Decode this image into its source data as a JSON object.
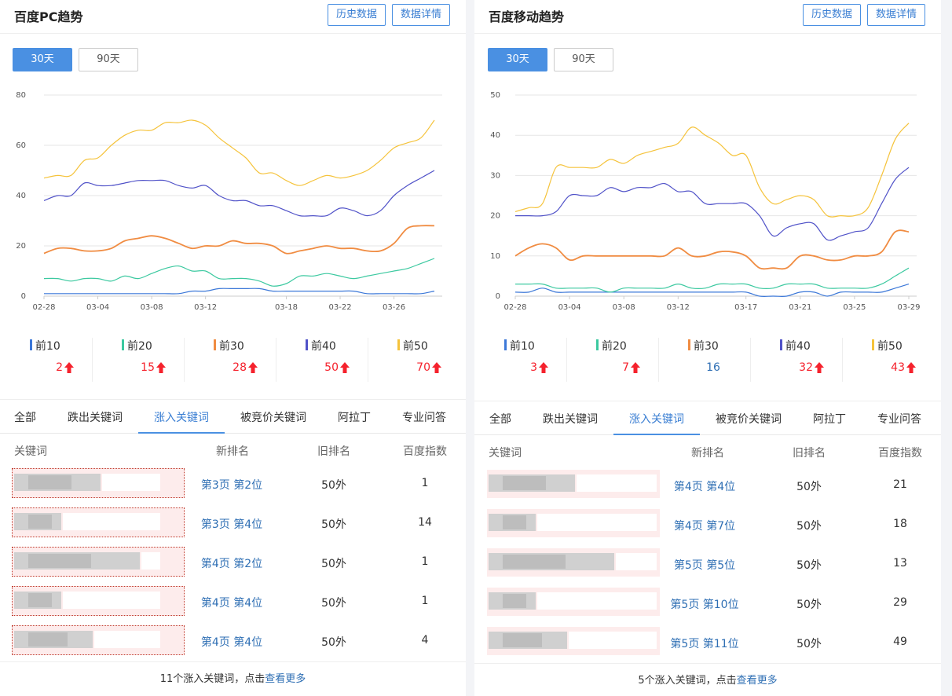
{
  "pc": {
    "title": "百度PC趋势",
    "btn_history": "历史数据",
    "btn_detail": "数据详情",
    "range_30": "30天",
    "range_90": "90天",
    "chart_data": {
      "type": "line",
      "x": [
        "02-28",
        "03-01",
        "03-02",
        "03-03",
        "03-04",
        "03-05",
        "03-06",
        "03-07",
        "03-08",
        "03-09",
        "03-10",
        "03-11",
        "03-12",
        "03-13",
        "03-14",
        "03-15",
        "03-16",
        "03-17",
        "03-18",
        "03-19",
        "03-20",
        "03-21",
        "03-22",
        "03-23",
        "03-24",
        "03-25",
        "03-26",
        "03-27",
        "03-28",
        "03-29"
      ],
      "xticks": [
        "02-28",
        "03-04",
        "03-08",
        "03-12",
        "03-18",
        "03-22",
        "03-26"
      ],
      "ylim": [
        0,
        80
      ],
      "yticks": [
        0,
        20,
        40,
        60,
        80
      ],
      "series": [
        {
          "name": "前10",
          "color": "#3c78d8",
          "values": [
            1,
            1,
            1,
            1,
            1,
            1,
            1,
            1,
            1,
            1,
            1,
            2,
            2,
            3,
            3,
            3,
            3,
            2,
            2,
            2,
            2,
            2,
            2,
            2,
            1,
            1,
            1,
            1,
            1,
            2
          ]
        },
        {
          "name": "前20",
          "color": "#3cc9a0",
          "values": [
            7,
            7,
            6,
            7,
            7,
            6,
            8,
            7,
            9,
            11,
            12,
            10,
            10,
            7,
            7,
            7,
            6,
            4,
            5,
            8,
            8,
            9,
            8,
            7,
            8,
            9,
            10,
            11,
            13,
            15
          ]
        },
        {
          "name": "前30",
          "color": "#f08c42",
          "values": [
            17,
            19,
            19,
            18,
            18,
            19,
            22,
            23,
            24,
            23,
            21,
            19,
            20,
            20,
            22,
            21,
            21,
            20,
            17,
            18,
            19,
            20,
            19,
            19,
            18,
            18,
            21,
            27,
            28,
            28
          ]
        },
        {
          "name": "前40",
          "color": "#5052c8",
          "values": [
            38,
            40,
            40,
            45,
            44,
            44,
            45,
            46,
            46,
            46,
            44,
            43,
            44,
            40,
            38,
            38,
            36,
            36,
            34,
            32,
            32,
            32,
            35,
            34,
            32,
            34,
            40,
            44,
            47,
            50
          ]
        },
        {
          "name": "前50",
          "color": "#f5c33b",
          "values": [
            47,
            48,
            48,
            54,
            55,
            60,
            64,
            66,
            66,
            69,
            69,
            70,
            68,
            63,
            59,
            55,
            49,
            49,
            46,
            44,
            46,
            48,
            47,
            48,
            50,
            54,
            59,
            61,
            63,
            70
          ]
        }
      ]
    },
    "legend": [
      {
        "name": "前10",
        "color": "#3c78d8",
        "value": "2",
        "trend": "up"
      },
      {
        "name": "前20",
        "color": "#3cc9a0",
        "value": "15",
        "trend": "up"
      },
      {
        "name": "前30",
        "color": "#f08c42",
        "value": "28",
        "trend": "up"
      },
      {
        "name": "前40",
        "color": "#5052c8",
        "value": "50",
        "trend": "up"
      },
      {
        "name": "前50",
        "color": "#f5c33b",
        "value": "70",
        "trend": "up"
      }
    ],
    "tabs": [
      "全部",
      "跌出关键词",
      "涨入关键词",
      "被竞价关键词",
      "阿拉丁",
      "专业问答"
    ],
    "active_tab": 2,
    "table_headers": [
      "关键词",
      "新排名",
      "旧排名",
      "百度指数"
    ],
    "rows": [
      {
        "new_rank": "第3页 第2位",
        "old_rank": "50外",
        "index": "1"
      },
      {
        "new_rank": "第3页 第4位",
        "old_rank": "50外",
        "index": "14"
      },
      {
        "new_rank": "第4页 第2位",
        "old_rank": "50外",
        "index": "1"
      },
      {
        "new_rank": "第4页 第4位",
        "old_rank": "50外",
        "index": "1"
      },
      {
        "new_rank": "第4页 第4位",
        "old_rank": "50外",
        "index": "4"
      }
    ],
    "footer_text": "11个涨入关键词，点击",
    "footer_link": "查看更多"
  },
  "mobile": {
    "title": "百度移动趋势",
    "btn_history": "历史数据",
    "btn_detail": "数据详情",
    "range_30": "30天",
    "range_90": "90天",
    "chart_data": {
      "type": "line",
      "x": [
        "02-28",
        "03-01",
        "03-02",
        "03-03",
        "03-04",
        "03-05",
        "03-06",
        "03-07",
        "03-08",
        "03-09",
        "03-10",
        "03-11",
        "03-12",
        "03-13",
        "03-14",
        "03-15",
        "03-16",
        "03-17",
        "03-18",
        "03-19",
        "03-20",
        "03-21",
        "03-22",
        "03-23",
        "03-24",
        "03-25",
        "03-26",
        "03-27",
        "03-28",
        "03-29"
      ],
      "xticks": [
        "02-28",
        "03-04",
        "03-08",
        "03-12",
        "03-17",
        "03-21",
        "03-25",
        "03-29"
      ],
      "ylim": [
        0,
        50
      ],
      "yticks": [
        0,
        10,
        20,
        30,
        40,
        50
      ],
      "series": [
        {
          "name": "前10",
          "color": "#3c78d8",
          "values": [
            1,
            1,
            2,
            1,
            1,
            1,
            1,
            1,
            1,
            1,
            1,
            1,
            1,
            1,
            1,
            1,
            1,
            1,
            0,
            0,
            0,
            1,
            1,
            0,
            1,
            1,
            1,
            1,
            2,
            3
          ]
        },
        {
          "name": "前20",
          "color": "#3cc9a0",
          "values": [
            3,
            3,
            3,
            2,
            2,
            2,
            2,
            1,
            2,
            2,
            2,
            2,
            3,
            2,
            2,
            3,
            3,
            3,
            2,
            2,
            3,
            3,
            3,
            2,
            2,
            2,
            2,
            3,
            5,
            7
          ]
        },
        {
          "name": "前30",
          "color": "#f08c42",
          "values": [
            10,
            12,
            13,
            12,
            9,
            10,
            10,
            10,
            10,
            10,
            10,
            10,
            12,
            10,
            10,
            11,
            11,
            10,
            7,
            7,
            7,
            10,
            10,
            9,
            9,
            10,
            10,
            11,
            16,
            16
          ]
        },
        {
          "name": "前40",
          "color": "#5052c8",
          "values": [
            20,
            20,
            20,
            21,
            25,
            25,
            25,
            27,
            26,
            27,
            27,
            28,
            26,
            26,
            23,
            23,
            23,
            23,
            20,
            15,
            17,
            18,
            18,
            14,
            15,
            16,
            17,
            23,
            29,
            32
          ]
        },
        {
          "name": "前50",
          "color": "#f5c33b",
          "values": [
            21,
            22,
            23,
            32,
            32,
            32,
            32,
            34,
            33,
            35,
            36,
            37,
            38,
            42,
            40,
            38,
            35,
            35,
            27,
            23,
            24,
            25,
            24,
            20,
            20,
            20,
            22,
            30,
            39,
            43
          ]
        }
      ]
    },
    "legend": [
      {
        "name": "前10",
        "color": "#3c78d8",
        "value": "3",
        "trend": "up"
      },
      {
        "name": "前20",
        "color": "#3cc9a0",
        "value": "7",
        "trend": "up"
      },
      {
        "name": "前30",
        "color": "#f08c42",
        "value": "16",
        "trend": "flat"
      },
      {
        "name": "前40",
        "color": "#5052c8",
        "value": "32",
        "trend": "up"
      },
      {
        "name": "前50",
        "color": "#f5c33b",
        "value": "43",
        "trend": "up"
      }
    ],
    "tabs": [
      "全部",
      "跌出关键词",
      "涨入关键词",
      "被竞价关键词",
      "阿拉丁",
      "专业问答"
    ],
    "active_tab": 2,
    "table_headers": [
      "关键词",
      "新排名",
      "旧排名",
      "百度指数"
    ],
    "rows": [
      {
        "new_rank": "第4页 第4位",
        "old_rank": "50外",
        "index": "21"
      },
      {
        "new_rank": "第4页 第7位",
        "old_rank": "50外",
        "index": "18"
      },
      {
        "new_rank": "第5页 第5位",
        "old_rank": "50外",
        "index": "13"
      },
      {
        "new_rank": "第5页 第10位",
        "old_rank": "50外",
        "index": "29"
      },
      {
        "new_rank": "第5页 第11位",
        "old_rank": "50外",
        "index": "49"
      }
    ],
    "footer_text": "5个涨入关键词，点击",
    "footer_link": "查看更多"
  }
}
